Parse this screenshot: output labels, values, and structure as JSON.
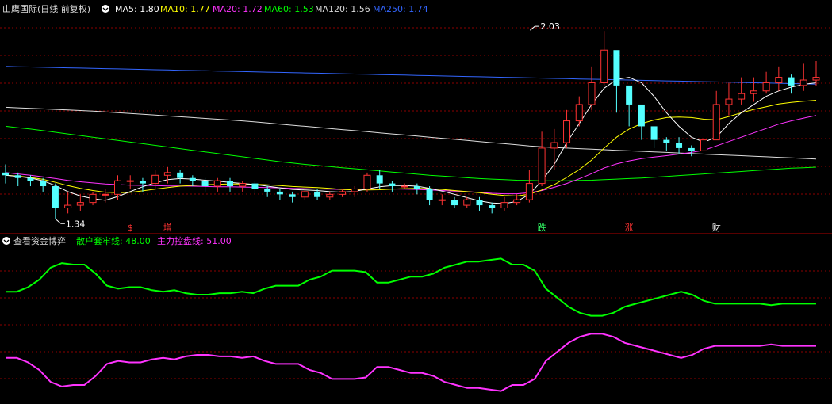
{
  "upper_panel": {
    "title": "山鹰国际(日线 前复权)",
    "indicators": [
      {
        "label": "MA5: 1.80",
        "color": "#ffffff"
      },
      {
        "label": "MA10: 1.77",
        "color": "#ffff00"
      },
      {
        "label": "MA20: 1.72",
        "color": "#ff33ff"
      },
      {
        "label": "MA60: 1.53",
        "color": "#00ff00"
      },
      {
        "label": "MA120: 1.56",
        "color": "#dddddd"
      },
      {
        "label": "MA250: 1.74",
        "color": "#3366ff"
      }
    ]
  },
  "lower_panel": {
    "title": "查看资金博弈",
    "indicators": [
      {
        "label": "散户套牢线: 48.00",
        "color": "#00ff00"
      },
      {
        "label": "主力控盘线: 51.00",
        "color": "#ff33ff"
      }
    ]
  },
  "colors": {
    "up": "#ff3333",
    "down": "#54ffff",
    "grid": "#8b0000",
    "ma5": "#ffffff",
    "ma10": "#ffff00",
    "ma20": "#ff33ff",
    "ma60": "#00ff00",
    "ma120": "#dddddd",
    "ma250": "#3366ff"
  },
  "chart_data": [
    {
      "type": "candlestick",
      "annotations": [
        {
          "text": "2.03",
          "x": 42,
          "y": 2.03,
          "kind": "high"
        },
        {
          "text": "1.34",
          "x": 4,
          "y": 1.34,
          "kind": "low"
        }
      ],
      "markers": [
        {
          "text": "$",
          "x": 10,
          "color": "#ff3333"
        },
        {
          "text": "增",
          "x": 13,
          "color": "#ff3333"
        },
        {
          "text": "跌",
          "x": 43,
          "color": "#33ff66"
        },
        {
          "text": "涨",
          "x": 50,
          "color": "#ff3333"
        },
        {
          "text": "财",
          "x": 57,
          "color": "#ffffff"
        }
      ],
      "ylim": [
        1.3,
        2.08
      ],
      "candles": [
        [
          1.51,
          1.5,
          1.54,
          1.47
        ],
        [
          1.5,
          1.49,
          1.51,
          1.46
        ],
        [
          1.49,
          1.48,
          1.5,
          1.46
        ],
        [
          1.48,
          1.46,
          1.49,
          1.44
        ],
        [
          1.46,
          1.38,
          1.47,
          1.34
        ],
        [
          1.38,
          1.39,
          1.44,
          1.36
        ],
        [
          1.39,
          1.4,
          1.43,
          1.37
        ],
        [
          1.4,
          1.43,
          1.44,
          1.39
        ],
        [
          1.43,
          1.43,
          1.45,
          1.4
        ],
        [
          1.43,
          1.48,
          1.5,
          1.41
        ],
        [
          1.48,
          1.48,
          1.5,
          1.45
        ],
        [
          1.48,
          1.47,
          1.49,
          1.44
        ],
        [
          1.47,
          1.5,
          1.52,
          1.45
        ],
        [
          1.5,
          1.51,
          1.53,
          1.47
        ],
        [
          1.51,
          1.49,
          1.52,
          1.47
        ],
        [
          1.49,
          1.48,
          1.5,
          1.46
        ],
        [
          1.48,
          1.46,
          1.49,
          1.44
        ],
        [
          1.46,
          1.48,
          1.49,
          1.44
        ],
        [
          1.48,
          1.46,
          1.49,
          1.44
        ],
        [
          1.46,
          1.47,
          1.48,
          1.44
        ],
        [
          1.47,
          1.45,
          1.48,
          1.43
        ],
        [
          1.45,
          1.44,
          1.46,
          1.42
        ],
        [
          1.44,
          1.43,
          1.45,
          1.41
        ],
        [
          1.43,
          1.42,
          1.44,
          1.4
        ],
        [
          1.42,
          1.44,
          1.45,
          1.41
        ],
        [
          1.44,
          1.42,
          1.45,
          1.41
        ],
        [
          1.42,
          1.43,
          1.44,
          1.41
        ],
        [
          1.43,
          1.44,
          1.45,
          1.42
        ],
        [
          1.44,
          1.45,
          1.46,
          1.42
        ],
        [
          1.45,
          1.5,
          1.51,
          1.44
        ],
        [
          1.5,
          1.47,
          1.52,
          1.45
        ],
        [
          1.47,
          1.46,
          1.48,
          1.44
        ],
        [
          1.46,
          1.46,
          1.47,
          1.45
        ],
        [
          1.46,
          1.45,
          1.47,
          1.43
        ],
        [
          1.45,
          1.41,
          1.46,
          1.39
        ],
        [
          1.41,
          1.41,
          1.43,
          1.39
        ],
        [
          1.41,
          1.39,
          1.42,
          1.38
        ],
        [
          1.39,
          1.41,
          1.42,
          1.38
        ],
        [
          1.41,
          1.39,
          1.42,
          1.37
        ],
        [
          1.39,
          1.38,
          1.4,
          1.36
        ],
        [
          1.38,
          1.4,
          1.42,
          1.37
        ],
        [
          1.4,
          1.41,
          1.43,
          1.39
        ],
        [
          1.41,
          1.47,
          1.52,
          1.4
        ],
        [
          1.47,
          1.6,
          1.66,
          1.46
        ],
        [
          1.6,
          1.62,
          1.67,
          1.52
        ],
        [
          1.62,
          1.7,
          1.74,
          1.6
        ],
        [
          1.7,
          1.76,
          1.79,
          1.68
        ],
        [
          1.76,
          1.84,
          1.9,
          1.74
        ],
        [
          1.84,
          1.96,
          2.03,
          1.83
        ],
        [
          1.96,
          1.83,
          1.88,
          1.73
        ],
        [
          1.83,
          1.76,
          1.77,
          1.68
        ],
        [
          1.76,
          1.68,
          1.72,
          1.63
        ],
        [
          1.68,
          1.63,
          1.65,
          1.6
        ],
        [
          1.63,
          1.62,
          1.64,
          1.59
        ],
        [
          1.62,
          1.6,
          1.64,
          1.58
        ],
        [
          1.6,
          1.59,
          1.61,
          1.57
        ],
        [
          1.59,
          1.63,
          1.67,
          1.58
        ],
        [
          1.63,
          1.76,
          1.81,
          1.71
        ],
        [
          1.76,
          1.78,
          1.84,
          1.72
        ],
        [
          1.78,
          1.8,
          1.86,
          1.76
        ],
        [
          1.8,
          1.81,
          1.86,
          1.77
        ],
        [
          1.81,
          1.84,
          1.88,
          1.8
        ],
        [
          1.84,
          1.86,
          1.9,
          1.81
        ],
        [
          1.86,
          1.83,
          1.87,
          1.8
        ],
        [
          1.83,
          1.85,
          1.91,
          1.81
        ],
        [
          1.85,
          1.86,
          1.92,
          1.83
        ]
      ],
      "series": [
        {
          "key": "ma250",
          "values": [
            1.9,
            1.899,
            1.898,
            1.897,
            1.896,
            1.895,
            1.894,
            1.893,
            1.892,
            1.891,
            1.89,
            1.889,
            1.888,
            1.887,
            1.886,
            1.885,
            1.884,
            1.883,
            1.882,
            1.881,
            1.88,
            1.879,
            1.878,
            1.877,
            1.876,
            1.875,
            1.874,
            1.873,
            1.872,
            1.871,
            1.87,
            1.869,
            1.868,
            1.867,
            1.866,
            1.865,
            1.864,
            1.863,
            1.862,
            1.861,
            1.86,
            1.859,
            1.858,
            1.857,
            1.856,
            1.855,
            1.854,
            1.853,
            1.852,
            1.851,
            1.85,
            1.849,
            1.848,
            1.847,
            1.846,
            1.845,
            1.844,
            1.843,
            1.842,
            1.841,
            1.84,
            1.839,
            1.838,
            1.837,
            1.836,
            1.835
          ]
        },
        {
          "key": "ma120",
          "values": [
            1.75,
            1.748,
            1.746,
            1.744,
            1.742,
            1.74,
            1.738,
            1.736,
            1.733,
            1.73,
            1.727,
            1.724,
            1.721,
            1.718,
            1.715,
            1.712,
            1.709,
            1.706,
            1.703,
            1.7,
            1.696,
            1.692,
            1.688,
            1.684,
            1.68,
            1.676,
            1.672,
            1.668,
            1.664,
            1.66,
            1.656,
            1.652,
            1.648,
            1.644,
            1.64,
            1.636,
            1.632,
            1.628,
            1.624,
            1.62,
            1.616,
            1.612,
            1.608,
            1.605,
            1.602,
            1.6,
            1.598,
            1.596,
            1.594,
            1.592,
            1.59,
            1.588,
            1.586,
            1.584,
            1.582,
            1.58,
            1.578,
            1.576,
            1.574,
            1.572,
            1.57,
            1.568,
            1.566,
            1.564,
            1.562,
            1.56
          ]
        },
        {
          "key": "ma60",
          "values": [
            1.68,
            1.675,
            1.67,
            1.664,
            1.658,
            1.652,
            1.646,
            1.64,
            1.634,
            1.628,
            1.622,
            1.616,
            1.61,
            1.604,
            1.598,
            1.592,
            1.586,
            1.58,
            1.574,
            1.568,
            1.562,
            1.556,
            1.55,
            1.545,
            1.54,
            1.536,
            1.532,
            1.528,
            1.524,
            1.52,
            1.516,
            1.512,
            1.508,
            1.504,
            1.5,
            1.497,
            1.494,
            1.491,
            1.488,
            1.486,
            1.484,
            1.482,
            1.481,
            1.48,
            1.48,
            1.48,
            1.481,
            1.482,
            1.484,
            1.486,
            1.488,
            1.49,
            1.493,
            1.496,
            1.499,
            1.502,
            1.505,
            1.508,
            1.511,
            1.514,
            1.517,
            1.52,
            1.523,
            1.526,
            1.528,
            1.53
          ]
        },
        {
          "key": "ma20",
          "values": [
            1.51,
            1.505,
            1.5,
            1.494,
            1.488,
            1.481,
            1.476,
            1.472,
            1.468,
            1.466,
            1.464,
            1.463,
            1.462,
            1.461,
            1.461,
            1.46,
            1.459,
            1.458,
            1.458,
            1.457,
            1.456,
            1.455,
            1.454,
            1.452,
            1.451,
            1.45,
            1.449,
            1.448,
            1.448,
            1.449,
            1.45,
            1.45,
            1.449,
            1.448,
            1.446,
            1.444,
            1.442,
            1.44,
            1.437,
            1.434,
            1.432,
            1.432,
            1.436,
            1.444,
            1.456,
            1.47,
            1.487,
            1.506,
            1.527,
            1.542,
            1.553,
            1.561,
            1.567,
            1.572,
            1.578,
            1.584,
            1.592,
            1.608,
            1.624,
            1.64,
            1.656,
            1.672,
            1.688,
            1.7,
            1.71,
            1.72
          ]
        },
        {
          "key": "ma10",
          "values": [
            1.5,
            1.497,
            1.492,
            1.485,
            1.474,
            1.462,
            1.452,
            1.444,
            1.438,
            1.436,
            1.437,
            1.443,
            1.449,
            1.455,
            1.46,
            1.463,
            1.465,
            1.467,
            1.468,
            1.468,
            1.467,
            1.465,
            1.462,
            1.459,
            1.457,
            1.455,
            1.452,
            1.448,
            1.446,
            1.446,
            1.447,
            1.449,
            1.451,
            1.452,
            1.451,
            1.448,
            1.444,
            1.44,
            1.436,
            1.43,
            1.426,
            1.424,
            1.43,
            1.446,
            1.466,
            1.492,
            1.521,
            1.556,
            1.6,
            1.64,
            1.67,
            1.69,
            1.703,
            1.712,
            1.714,
            1.712,
            1.706,
            1.704,
            1.716,
            1.73,
            1.742,
            1.752,
            1.762,
            1.768,
            1.772,
            1.776
          ]
        },
        {
          "key": "ma5",
          "values": [
            1.5,
            1.496,
            1.49,
            1.48,
            1.462,
            1.44,
            1.424,
            1.414,
            1.408,
            1.422,
            1.44,
            1.458,
            1.473,
            1.484,
            1.488,
            1.486,
            1.482,
            1.478,
            1.474,
            1.47,
            1.466,
            1.46,
            1.454,
            1.448,
            1.446,
            1.444,
            1.44,
            1.438,
            1.441,
            1.45,
            1.458,
            1.462,
            1.462,
            1.46,
            1.452,
            1.442,
            1.43,
            1.418,
            1.406,
            1.398,
            1.396,
            1.404,
            1.43,
            1.48,
            1.54,
            1.62,
            1.69,
            1.76,
            1.82,
            1.852,
            1.86,
            1.84,
            1.79,
            1.73,
            1.68,
            1.64,
            1.622,
            1.64,
            1.69,
            1.73,
            1.76,
            1.79,
            1.81,
            1.824,
            1.834,
            1.84
          ]
        }
      ]
    },
    {
      "type": "line",
      "ylim": [
        0,
        100
      ],
      "series": [
        {
          "name": "散户套牢线",
          "key": "green",
          "values": [
            72,
            72,
            75,
            80,
            88,
            91,
            90,
            90,
            84,
            76,
            74,
            75,
            75,
            73,
            72,
            73,
            71,
            70,
            70,
            71,
            71,
            72,
            71,
            74,
            76,
            76,
            76,
            80,
            82,
            86,
            86,
            86,
            85,
            78,
            78,
            80,
            82,
            82,
            84,
            88,
            90,
            92,
            92,
            93,
            94,
            90,
            90,
            86,
            74,
            68,
            62,
            58,
            56,
            56,
            58,
            62,
            64,
            66,
            68,
            70,
            72,
            70,
            66,
            64,
            64,
            64,
            64,
            64,
            63,
            64,
            64,
            64,
            64
          ]
        },
        {
          "name": "主力控盘线",
          "key": "magenta",
          "values": [
            28,
            28,
            25,
            20,
            12,
            9,
            10,
            10,
            16,
            24,
            26,
            25,
            25,
            27,
            28,
            27,
            29,
            30,
            30,
            29,
            29,
            28,
            29,
            26,
            24,
            24,
            24,
            20,
            18,
            14,
            14,
            14,
            15,
            22,
            22,
            20,
            18,
            18,
            16,
            12,
            10,
            8,
            8,
            7,
            6,
            10,
            10,
            14,
            26,
            32,
            38,
            42,
            44,
            44,
            42,
            38,
            36,
            34,
            32,
            30,
            28,
            30,
            34,
            36,
            36,
            36,
            36,
            36,
            37,
            36,
            36,
            36,
            36
          ]
        }
      ]
    }
  ]
}
